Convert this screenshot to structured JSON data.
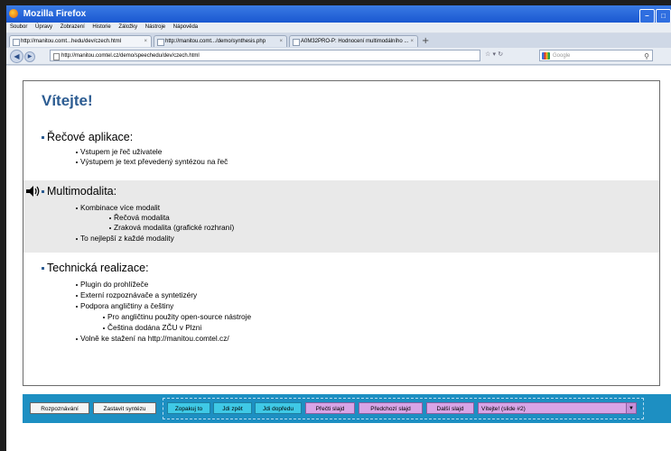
{
  "window": {
    "title": "Mozilla Firefox"
  },
  "menu": [
    "Soubor",
    "Úpravy",
    "Zobrazení",
    "Historie",
    "Záložky",
    "Nástroje",
    "Nápověda"
  ],
  "tabs": [
    {
      "label": "http://manitou.comt...hedu/dev/czech.html"
    },
    {
      "label": "http://manitou.comt.../demo/synthesis.php"
    },
    {
      "label": "A0M32PRO-P: Hodnocení multimodálního ..."
    }
  ],
  "navbar": {
    "url": "http://manitou.comtel.cz/demo/speechedu/dev/czech.html",
    "search_placeholder": "Google"
  },
  "slide": {
    "title": "Vítejte!",
    "sections": [
      {
        "title": "Řečové aplikace:",
        "items": [
          "Vstupem je řeč uživatele",
          "Výstupem je text převedený syntézou na řeč"
        ]
      },
      {
        "title": "Multimodalita:",
        "items": [
          "Kombinace více modalit",
          "Řečová modalita",
          "Zraková modalita (grafické rozhraní)",
          "To nejlepší z každé modality"
        ]
      },
      {
        "title": "Technická realizace:",
        "items": [
          "Plugin do prohlížeče",
          "Externí rozpoznávače a syntetizéry",
          "Podpora angličtiny a češtiny",
          "Pro angličtinu použity open-source nástroje",
          "Čeština dodána ZČU v Plzni",
          "Volně ke stažení na http://manitou.comtel.cz/"
        ]
      }
    ]
  },
  "controls": {
    "recognize": "Rozpoznávání",
    "stop_synthesis": "Zastavit syntézu",
    "repeat": "Zopakuj to",
    "back": "Jdi zpět",
    "forward": "Jdi dopředu",
    "read_slide": "Přečti slajd",
    "prev_slide": "Předchozí slajd",
    "next_slide": "Další slajd",
    "slide_select": "Vítejte! (slide #2)"
  },
  "colors": {
    "title": "#2c5c92",
    "bar": "#1d8fc2",
    "cyan_button": "#3fc9e6",
    "magenta_button": "#d8a4e6",
    "highlight": "#e9e9e9"
  }
}
